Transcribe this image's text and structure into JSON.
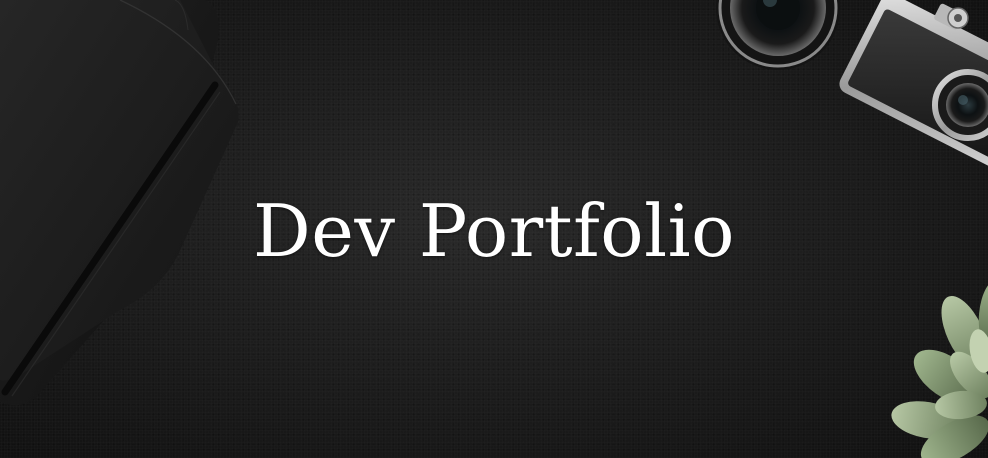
{
  "hero": {
    "title": "Dev Portfolio",
    "background_color": "#1b1b1b",
    "title_color": "#ffffff"
  },
  "decor": {
    "left": "notebook-icon",
    "top_right": "camera-icon",
    "bottom_right": "succulent-plant-icon"
  }
}
